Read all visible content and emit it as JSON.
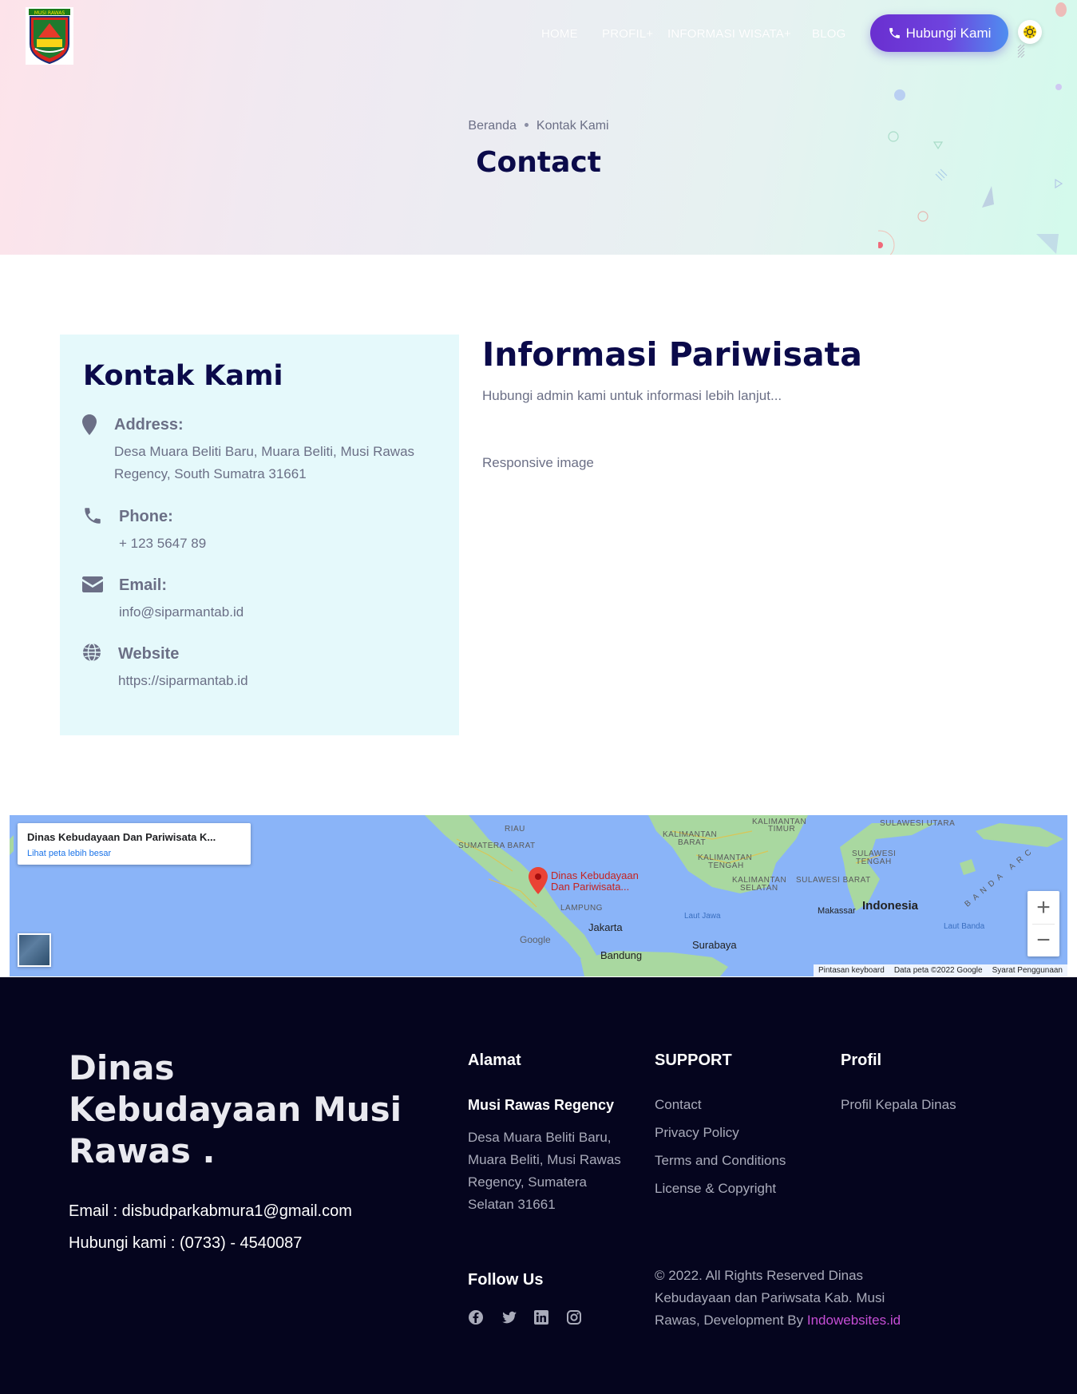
{
  "header": {
    "nav": [
      {
        "label": "HOME"
      },
      {
        "label": "PROFIL+"
      },
      {
        "label": "INFORMASI WISATA+"
      },
      {
        "label": "BLOG"
      }
    ],
    "cta_label": "Hubungi Kami",
    "logo_text": "MUSI RAWAS"
  },
  "hero": {
    "breadcrumb": [
      "Beranda",
      "Kontak Kami"
    ],
    "title": "Contact"
  },
  "contact_card": {
    "title": "Kontak Kami",
    "address_label": "Address:",
    "address_value": "Desa Muara Beliti Baru, Muara Beliti, Musi Rawas Regency, South Sumatra 31661",
    "phone_label": "Phone:",
    "phone_value": "+ 123 5647 89",
    "email_label": "Email:",
    "email_value": "info@siparmantab.id",
    "website_label": "Website",
    "website_value": "https://siparmantab.id"
  },
  "info": {
    "title": "Informasi Pariwisata",
    "subtitle": "Hubungi admin kami untuk informasi lebih lanjut...",
    "image_alt": "Responsive image"
  },
  "map": {
    "place_title": "Dinas Kebudayaan Dan Pariwisata K...",
    "larger_map_link": "Lihat peta lebih besar",
    "marker_label_1": "Dinas Kebudayaan",
    "marker_label_2": "Dan Pariwisata...",
    "zoom_in": "+",
    "zoom_out": "−",
    "attribution": [
      "Pintasan keyboard",
      "Data peta ©2022 Google",
      "Syarat Penggunaan"
    ],
    "labels": {
      "riau": "RIAU",
      "sumatera_barat": "SUMATERA BARAT",
      "lampung": "LAMPUNG",
      "kalimantan_barat_1": "KALIMANTAN",
      "kalimantan_barat_2": "BARAT",
      "kalimantan_tengah_1": "KALIMANTAN",
      "kalimantan_tengah_2": "TENGAH",
      "kalimantan_timur_1": "KALIMANTAN",
      "kalimantan_timur_2": "TIMUR",
      "kalimantan_selatan_1": "KALIMANTAN",
      "kalimantan_selatan_2": "SELATAN",
      "sulawesi_utara": "SULAWESI UTARA",
      "sulawesi_tengah_1": "SULAWESI",
      "sulawesi_tengah_2": "TENGAH",
      "sulawesi_barat": "SULAWESI BARAT",
      "banda_arc": "BANDA ARC",
      "jakarta": "Jakarta",
      "surabaya": "Surabaya",
      "bandung": "Bandung",
      "makassar": "Makassar",
      "indonesia": "Indonesia",
      "laut_jawa": "Laut Jawa",
      "laut_banda": "Laut Banda",
      "google": "Google"
    }
  },
  "footer": {
    "brand": "Dinas Kebudayaan Musi Rawas .",
    "email_line": "Email : disbudparkabmura1@gmail.com",
    "phone_line": "Hubungi kami : (0733) - 4540087",
    "alamat_heading": "Alamat",
    "alamat_sub": "Musi Rawas Regency",
    "alamat_text": "Desa Muara Beliti Baru, Muara Beliti, Musi Rawas Regency, Sumatera Selatan 31661",
    "support_heading": "SUPPORT",
    "support_links": [
      "Contact",
      "Privacy Policy",
      "Terms and Conditions",
      "License & Copyright"
    ],
    "profil_heading": "Profil",
    "profil_links": [
      "Profil Kepala Dinas"
    ],
    "follow_heading": "Follow Us",
    "copyright": "© 2022. All Rights Reserved Dinas Kebudayaan dan Pariwsata Kab. Musi Rawas, Development By",
    "dev_link": "Indowebsites.id",
    "colors": {
      "link_accent": "#c64ed6",
      "background": "#05051e"
    }
  },
  "colors": {
    "heading": "#0b0a4a",
    "cta_start": "#6a2fd0",
    "cta_end": "#4f8ef0",
    "card_bg": "#e5f9fb"
  }
}
